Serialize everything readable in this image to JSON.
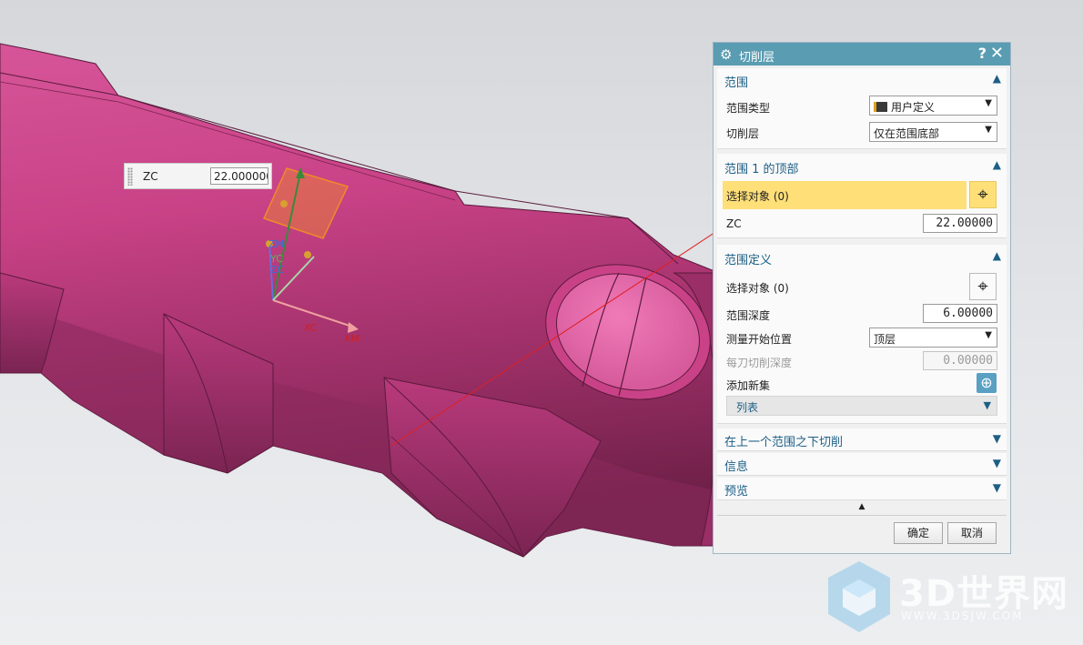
{
  "viewport": {
    "zc_float": {
      "label": "ZC",
      "value": "22.000000"
    },
    "triad_labels": {
      "zm": "ZM",
      "yc": "YC",
      "zc": "ZC",
      "xc": "XC",
      "xm": "XM"
    },
    "colors": {
      "part": "#c93f86",
      "arrow": "#e02020",
      "plane": "#f08a2a"
    }
  },
  "dialog": {
    "title": "切削层",
    "help": "?",
    "close": "✕",
    "sections": {
      "range": {
        "header": "范围",
        "range_type_label": "范围类型",
        "range_type_value": "用户定义",
        "cut_layer_label": "切削层",
        "cut_layer_value": "仅在范围底部"
      },
      "range_top": {
        "header": "范围 1 的顶部",
        "select_label": "选择对象 (0)",
        "zc_label": "ZC",
        "zc_value": "22.00000"
      },
      "range_def": {
        "header": "范围定义",
        "select_label": "选择对象 (0)",
        "depth_label": "范围深度",
        "depth_value": "6.00000",
        "measure_label": "测量开始位置",
        "measure_value": "顶层",
        "per_cut_label": "每刀切削深度",
        "per_cut_value": "0.00000",
        "add_label": "添加新集",
        "list_label": "列表"
      },
      "below": {
        "header": "在上一个范围之下切削"
      },
      "info": {
        "header": "信息"
      },
      "preview": {
        "header": "预览"
      }
    },
    "ok_label": "确定",
    "cancel_label": "取消"
  },
  "watermark": {
    "text": "3D世界网",
    "url": "WWW.3DSJW.COM"
  }
}
